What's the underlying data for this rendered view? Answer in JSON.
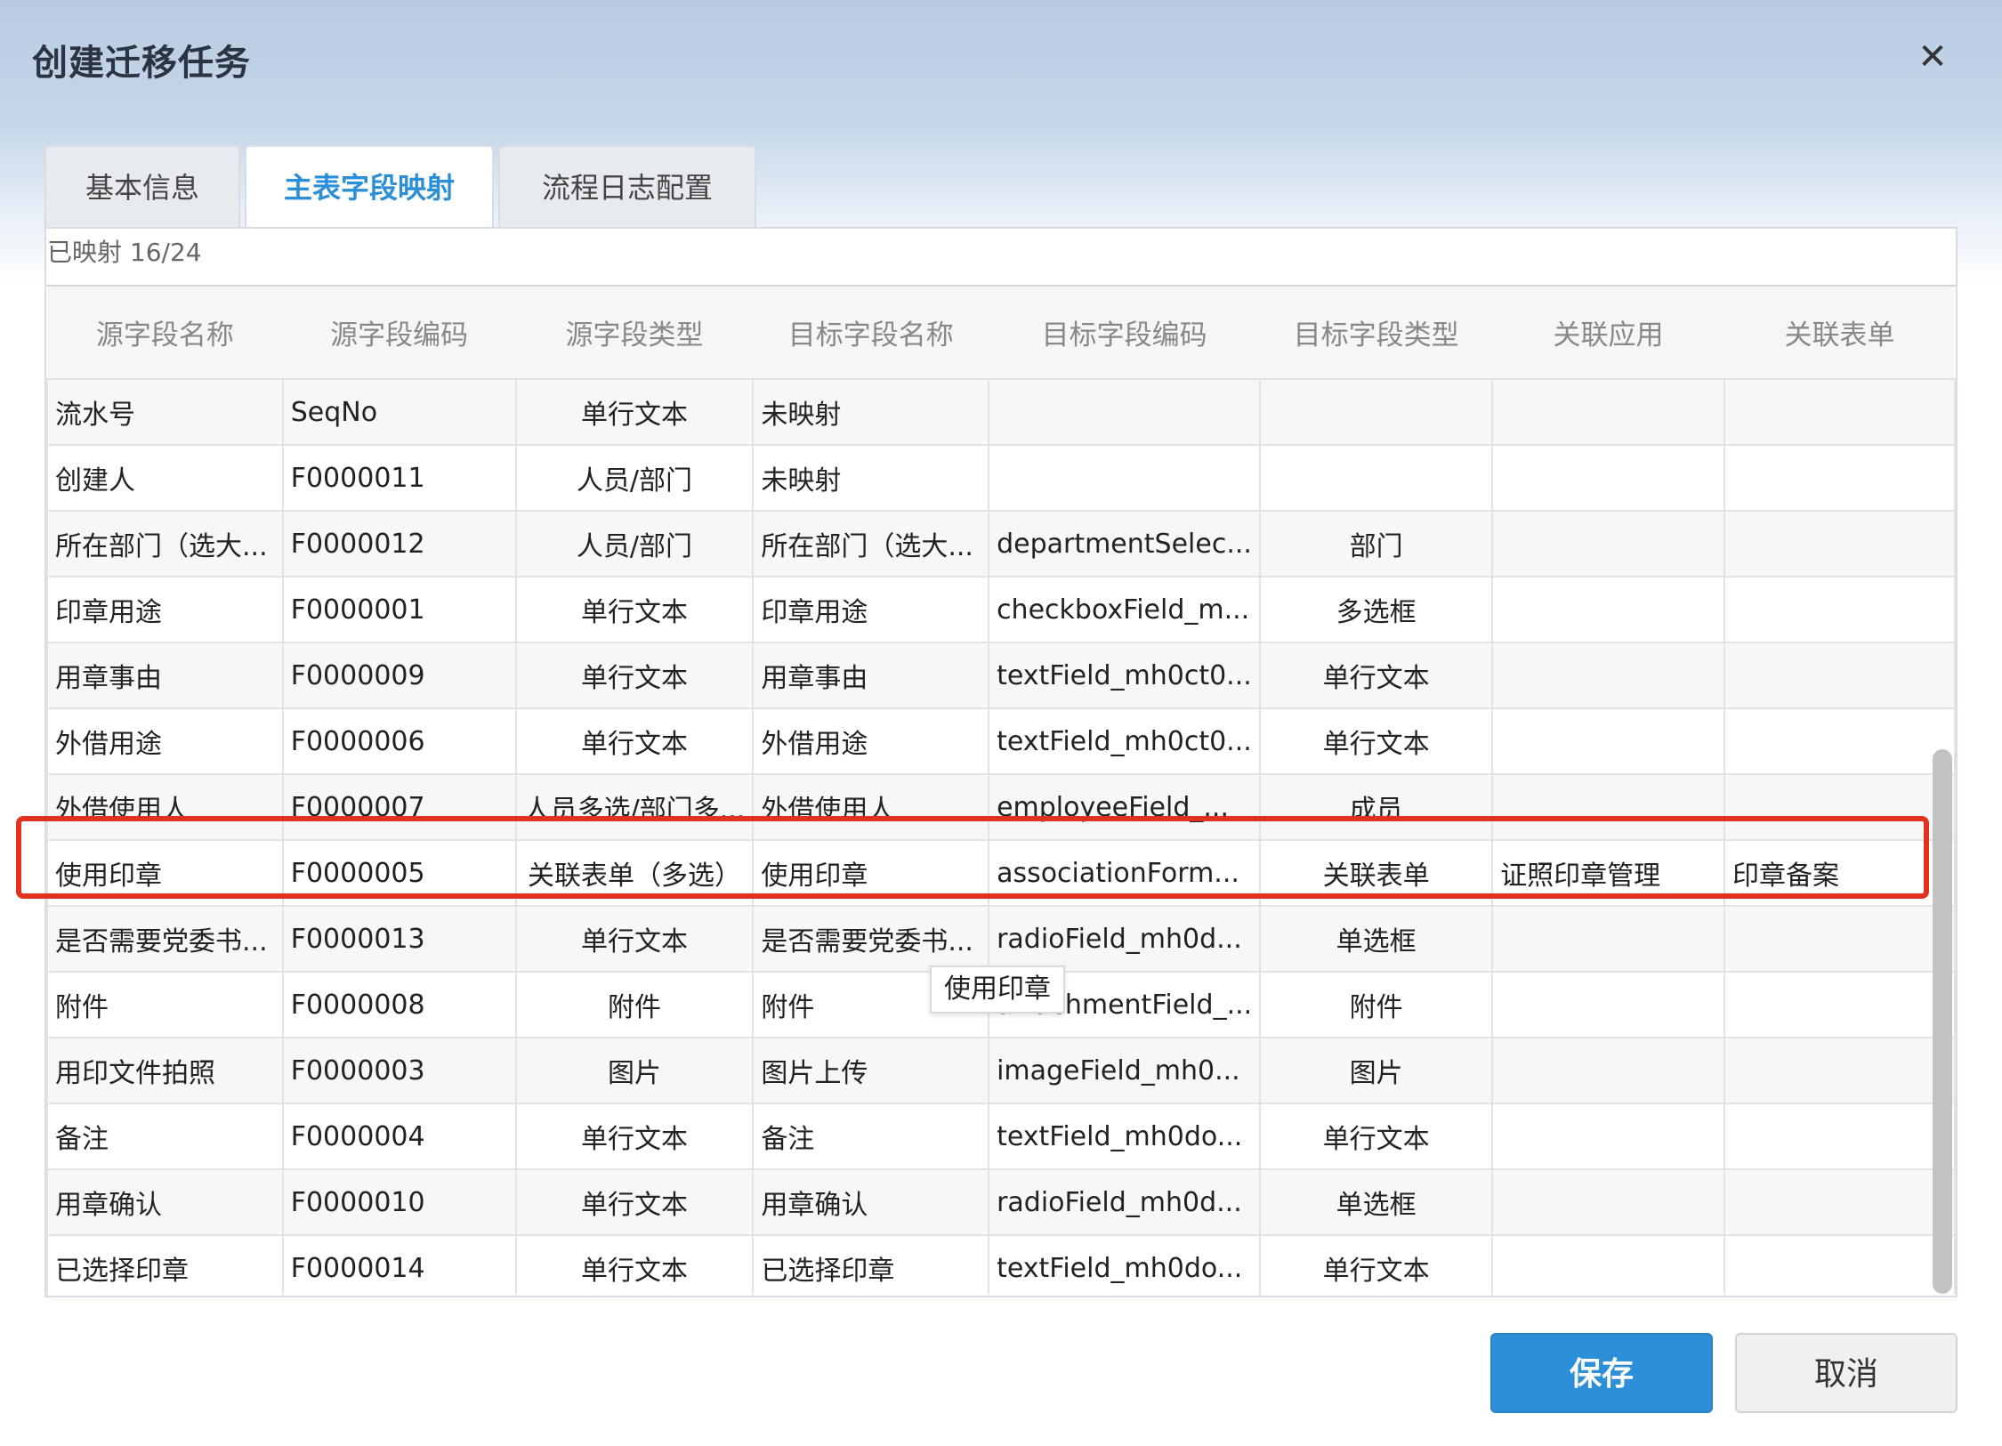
{
  "dialog": {
    "title": "创建迁移任务",
    "close_icon": "close-icon"
  },
  "tabs": [
    {
      "label": "基本信息",
      "active": false
    },
    {
      "label": "主表字段映射",
      "active": true
    },
    {
      "label": "流程日志配置",
      "active": false
    }
  ],
  "mapping": {
    "status_text": "已映射 16/24"
  },
  "table": {
    "headers": [
      "源字段名称",
      "源字段编码",
      "源字段类型",
      "目标字段名称",
      "目标字段编码",
      "目标字段类型",
      "关联应用",
      "关联表单"
    ],
    "rows": [
      [
        "流水号",
        "SeqNo",
        "单行文本",
        "未映射",
        "",
        "",
        "",
        ""
      ],
      [
        "创建人",
        "F0000011",
        "人员/部门",
        "未映射",
        "",
        "",
        "",
        ""
      ],
      [
        "所在部门（选大...",
        "F0000012",
        "人员/部门",
        "所在部门（选大...",
        "departmentSelec...",
        "部门",
        "",
        ""
      ],
      [
        "印章用途",
        "F0000001",
        "单行文本",
        "印章用途",
        "checkboxField_m...",
        "多选框",
        "",
        ""
      ],
      [
        "用章事由",
        "F0000009",
        "单行文本",
        "用章事由",
        "textField_mh0ct0...",
        "单行文本",
        "",
        ""
      ],
      [
        "外借用途",
        "F0000006",
        "单行文本",
        "外借用途",
        "textField_mh0ct0...",
        "单行文本",
        "",
        ""
      ],
      [
        "外借使用人",
        "F0000007",
        "人员多选/部门多...",
        "外借使用人",
        "employeeField_...",
        "成员",
        "",
        ""
      ],
      [
        "使用印章",
        "F0000005",
        "关联表单（多选）",
        "使用印章",
        "associationForm...",
        "关联表单",
        "证照印章管理",
        "印章备案"
      ],
      [
        "是否需要党委书...",
        "F0000013",
        "单行文本",
        "是否需要党委书...",
        "radioField_mh0d...",
        "单选框",
        "",
        ""
      ],
      [
        "附件",
        "F0000008",
        "附件",
        "附件",
        "attachmentField_...",
        "附件",
        "",
        ""
      ],
      [
        "用印文件拍照",
        "F0000003",
        "图片",
        "图片上传",
        "imageField_mh0...",
        "图片",
        "",
        ""
      ],
      [
        "备注",
        "F0000004",
        "单行文本",
        "备注",
        "textField_mh0do...",
        "单行文本",
        "",
        ""
      ],
      [
        "用章确认",
        "F0000010",
        "单行文本",
        "用章确认",
        "radioField_mh0d...",
        "单选框",
        "",
        ""
      ],
      [
        "已选择印章",
        "F0000014",
        "单行文本",
        "已选择印章",
        "textField_mh0do...",
        "单行文本",
        "",
        ""
      ]
    ]
  },
  "tooltip": {
    "text": "使用印章"
  },
  "footer": {
    "save_label": "保存",
    "cancel_label": "取消"
  },
  "colors": {
    "accent": "#2e8fd9",
    "highlight": "#e0321e"
  }
}
